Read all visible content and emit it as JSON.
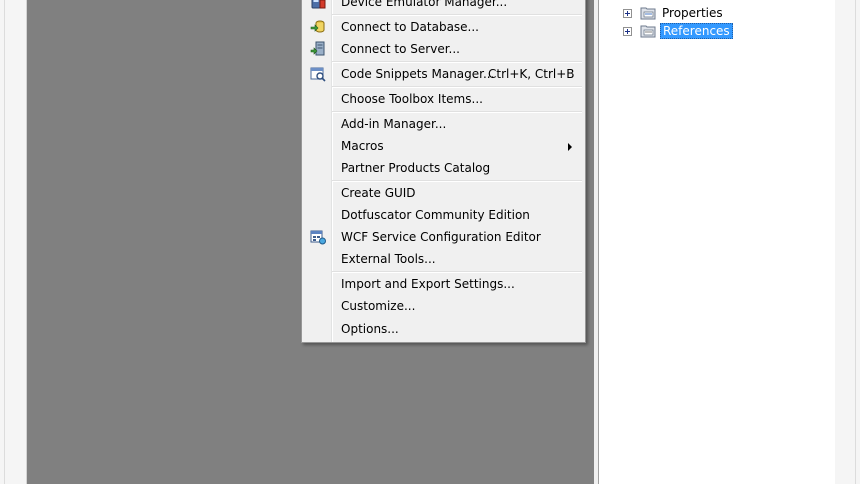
{
  "menu": {
    "items": [
      {
        "label": "Device Emulator Manager...",
        "icon": "device-emulator-icon"
      },
      {
        "label": "Connect to Database...",
        "icon": "database-connect-icon"
      },
      {
        "label": "Connect to Server...",
        "icon": "server-connect-icon"
      },
      {
        "label": "Code Snippets Manager...",
        "shortcut": "Ctrl+K, Ctrl+B",
        "icon": "snippets-icon"
      },
      {
        "label": "Choose Toolbox Items..."
      },
      {
        "label": "Add-in Manager..."
      },
      {
        "label": "Macros",
        "submenu": true
      },
      {
        "label": "Partner Products Catalog"
      },
      {
        "label": "Create GUID"
      },
      {
        "label": "Dotfuscator Community Edition"
      },
      {
        "label": "WCF Service Configuration Editor",
        "icon": "wcf-editor-icon"
      },
      {
        "label": "External Tools..."
      },
      {
        "label": "Import and Export Settings..."
      },
      {
        "label": "Customize..."
      },
      {
        "label": "Options..."
      }
    ]
  },
  "solution_explorer": {
    "nodes": [
      {
        "label": "Properties",
        "icon": "properties-folder-icon",
        "selected": false
      },
      {
        "label": "References",
        "icon": "references-folder-icon",
        "selected": true
      }
    ]
  },
  "colors": {
    "editor_background": "#808080",
    "selection": "#3399ff",
    "menu_background": "#f0f0f0"
  }
}
